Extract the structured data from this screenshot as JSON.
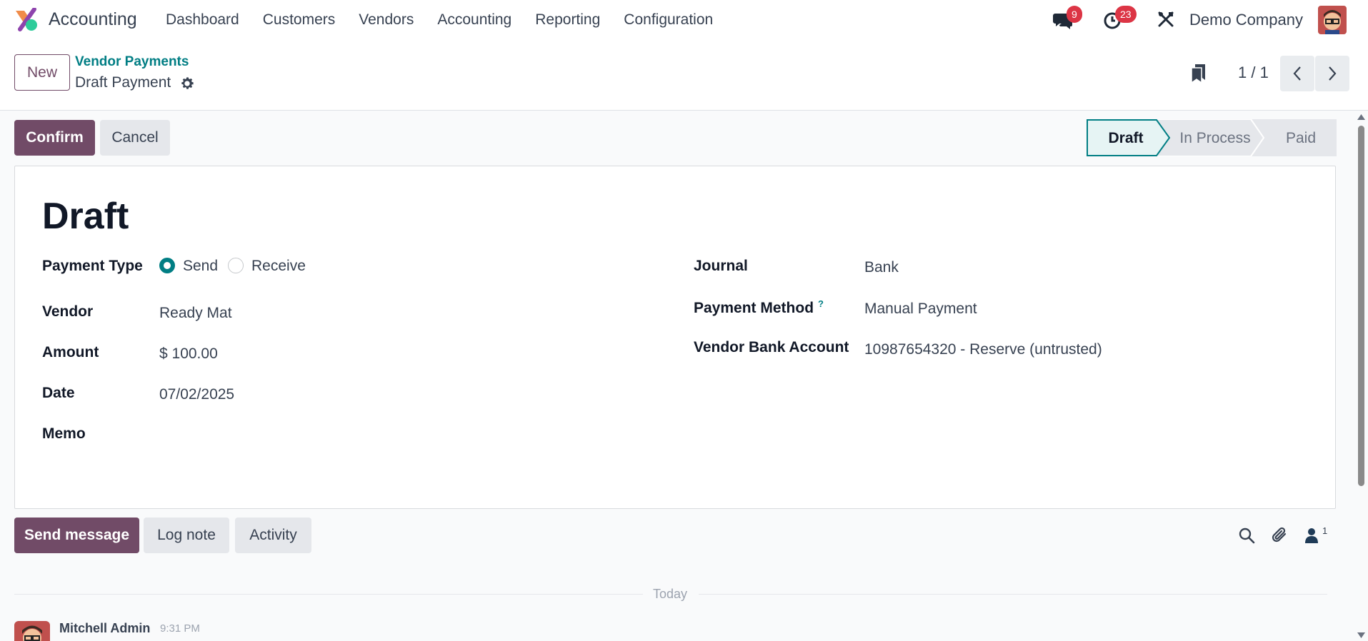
{
  "navbar": {
    "app_name": "Accounting",
    "menu": [
      "Dashboard",
      "Customers",
      "Vendors",
      "Accounting",
      "Reporting",
      "Configuration"
    ],
    "messages_badge": "9",
    "activities_badge": "23",
    "company": "Demo Company"
  },
  "control_panel": {
    "new_label": "New",
    "breadcrumb": "Vendor Payments",
    "record_title": "Draft Payment",
    "pager": "1 / 1"
  },
  "statusbar": {
    "confirm_label": "Confirm",
    "cancel_label": "Cancel",
    "stages": [
      "Draft",
      "In Process",
      "Paid"
    ],
    "active_stage": "Draft"
  },
  "form": {
    "state_title": "Draft",
    "payment_type_label": "Payment Type",
    "payment_type_options": [
      "Send",
      "Receive"
    ],
    "payment_type_selected": "Send",
    "vendor_label": "Vendor",
    "vendor_value": "Ready Mat",
    "amount_label": "Amount",
    "amount_value": "$ 100.00",
    "date_label": "Date",
    "date_value": "07/02/2025",
    "memo_label": "Memo",
    "memo_value": "",
    "journal_label": "Journal",
    "journal_value": "Bank",
    "payment_method_label": "Payment Method",
    "payment_method_help": "?",
    "payment_method_value": "Manual Payment",
    "bank_account_label": "Vendor Bank Account",
    "bank_account_value": "10987654320 - Reserve (untrusted)"
  },
  "chatter": {
    "send_message_label": "Send message",
    "log_note_label": "Log note",
    "activity_label": "Activity",
    "followers_count": "1",
    "date_separator": "Today",
    "messages": [
      {
        "author": "Mitchell Admin",
        "time": "9:31 PM"
      }
    ]
  },
  "colors": {
    "brand": "#714b67",
    "accent": "#017e84",
    "badge": "#dc3545"
  }
}
